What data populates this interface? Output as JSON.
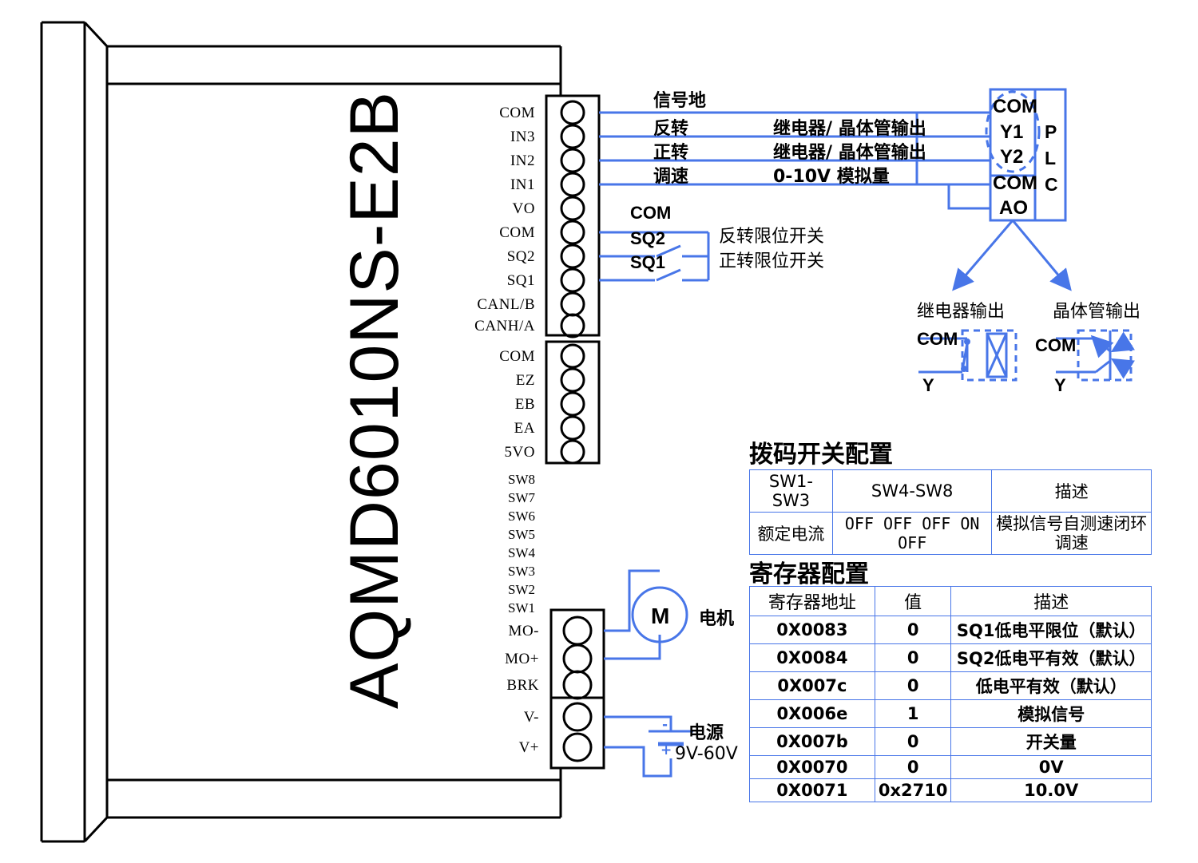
{
  "device": {
    "model": "AQMD6010NS-E2B",
    "terminal_block_1": [
      "COM",
      "IN3",
      "IN2",
      "IN1",
      "VO",
      "COM",
      "SQ2",
      "SQ1",
      "CANL/B",
      "CANH/A"
    ],
    "terminal_block_2": [
      "COM",
      "EZ",
      "EB",
      "EA",
      "5VO"
    ],
    "dip_labels": [
      "SW8",
      "SW7",
      "SW6",
      "SW5",
      "SW4",
      "SW3",
      "SW2",
      "SW1"
    ],
    "terminal_block_3": [
      "MO-",
      "MO+",
      "BRK"
    ],
    "terminal_block_4": [
      "V-",
      "V+"
    ]
  },
  "wires": {
    "signal_ground": "信号地",
    "reverse": "反转",
    "forward": "正转",
    "speed": "调速",
    "relay_transistor_out_1": "继电器/ 晶体管输出",
    "relay_transistor_out_2": "继电器/ 晶体管输出",
    "analog": "0-10V 模拟量"
  },
  "limit_switches": {
    "com_label": "COM",
    "sq2_label": "SQ2",
    "sq1_label": "SQ1",
    "sq2_desc": "反转限位开关",
    "sq1_desc": "正转限位开关"
  },
  "plc": {
    "name_chars": [
      "P",
      "L",
      "C"
    ],
    "pins_group_1": [
      "COM",
      "Y1",
      "Y2"
    ],
    "pins_group_2": [
      "COM",
      "AO"
    ]
  },
  "output_types": {
    "relay": {
      "title": "继电器输出",
      "com_label": "COM",
      "y_label": "Y"
    },
    "transistor": {
      "title": "晶体管输出",
      "com_label": "COM",
      "y_label": "Y"
    }
  },
  "motor": {
    "symbol": "M",
    "label": "电机"
  },
  "power": {
    "label": "电源",
    "range": "9V-60V",
    "minus": "-",
    "plus": "+"
  },
  "dip_config": {
    "title": "拨码开关配置",
    "headers": [
      "SW1-SW3",
      "SW4-SW8",
      "描述"
    ],
    "rows": [
      [
        "额定电流",
        "OFF OFF OFF ON OFF",
        "模拟信号自测速闭环调速"
      ]
    ]
  },
  "register_config": {
    "title": "寄存器配置",
    "headers": [
      "寄存器地址",
      "值",
      "描述"
    ],
    "rows": [
      [
        "0X0083",
        "0",
        "SQ1低电平限位（默认）"
      ],
      [
        "0X0084",
        "0",
        "SQ2低电平有效（默认）"
      ],
      [
        "0X007c",
        "0",
        "低电平有效（默认）"
      ],
      [
        "0X006e",
        "1",
        "模拟信号"
      ],
      [
        "0X007b",
        "0",
        "开关量"
      ],
      [
        "0X0070",
        "0",
        "0V"
      ],
      [
        "0X0071",
        "0x2710",
        "10.0V"
      ]
    ]
  },
  "colors": {
    "wire_blue": "#4876E8",
    "outline_black": "#000000",
    "background": "#ffffff"
  }
}
